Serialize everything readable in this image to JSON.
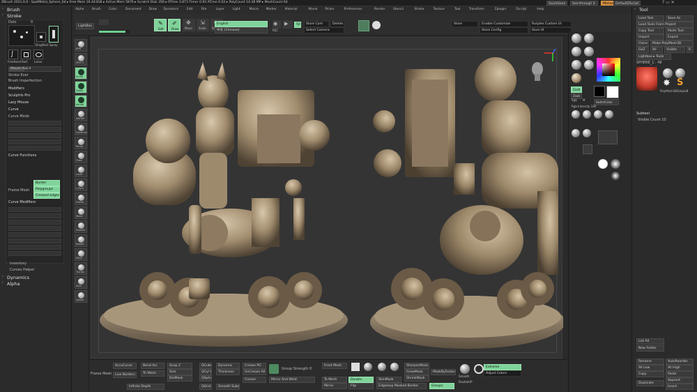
{
  "title_bar": {
    "title": "ZBrush 2021.6.6 : SpotMetal_Sphere_64 ▸ Free Mem 16.443GB ▸ Active Mem 5876 ▸ Scratch Disk 356 ▸ RTime 3.873 Timer 0.93 ATime 0.02 ▸ PolyCount 14.38 MP ▸ MeshCount 64",
    "quicksave": "QuickSave",
    "see_through": "See-through 0",
    "menus": "Menus",
    "default_zscript": "DefaultZScript"
  },
  "menu_bar": [
    "Alpha",
    "Brush",
    "Color",
    "Document",
    "Draw",
    "Dynamics",
    "Edit",
    "File",
    "Layer",
    "Light",
    "Macro",
    "Marker",
    "Material",
    "Movie",
    "Picker",
    "Preferences",
    "Render",
    "Stencil",
    "Stroke",
    "Texture",
    "Tool",
    "Transform",
    "Zplugin",
    "Zscript",
    "Help"
  ],
  "left_panel": {
    "brush_header": "Brush",
    "stroke_header": "Stroke",
    "dots_label": "Dots",
    "dots_value": "0",
    "stroke_icons": [
      "Dots",
      "DragRect",
      "Spray",
      "FreeHand",
      "Rect",
      "Lasso"
    ],
    "mouse_avg": "Mouse Avg 4",
    "stroke_button_a": "Stroke Ever",
    "stroke_button_b": "Brush Imperfection",
    "modifiers": "Modifiers",
    "sculptris_pro": "Sculptris Pro",
    "lazy_mouse": "Lazy Mouse",
    "curve": "Curve",
    "curve_mode": "Curve Mode",
    "curve_functions": "Curve Functions",
    "frame_mesh": "Frame Mesh",
    "border": "Border",
    "polygroups": "Polygroups",
    "crease_edges": "Creased edges",
    "curve_modifiers": "Curve Modifiers",
    "inventory": "Inventory",
    "curves_helper": "Curves Helper",
    "dynamics": "Dynamics",
    "alpha": "Alpha"
  },
  "top_shelf": {
    "lightbox": "LightBox",
    "edit": "Edit",
    "draw": "Draw",
    "move": "Move",
    "scale": "Scale",
    "rotate": "Rotate",
    "language": "English",
    "language_cn": "中文 (Chinese)",
    "rec": "REC",
    "zoom_label": "50",
    "store_cam": "Store Cam",
    "delete": "Delete",
    "select_camera": "Select Camera",
    "store": "Store",
    "enable_customize": "Enable Customize",
    "rurplex_custom": "Rurplex Custom UI",
    "store_config": "Store Config",
    "save_ui": "Save UI"
  },
  "left_shelf": [
    "BPR",
    "SPix 3",
    "Scroll",
    "Zoom",
    "Actual",
    "AAHalf",
    "Dynamic",
    "Persp",
    "Floor",
    "Local",
    "L.Sym",
    "Frame",
    "Move",
    "ZoomD",
    "Rotate",
    "PolyF",
    "Transp",
    "Solo",
    "Xpose"
  ],
  "right_side": {
    "tool_header": "Tool",
    "load_tool": "Load Tool",
    "save_as": "Save As",
    "load_tools_project": "Load Tools From Project",
    "copy_tool": "Copy Tool",
    "paste_tool": "Paste Tool",
    "import": "Import",
    "export": "Export",
    "clone": "Clone",
    "make_polymesh3d": "Make PolyMesh3D",
    "goz": "GoZ",
    "all": "All",
    "visible": "Visible",
    "r": "R",
    "lightbox_tools": "Lightbox ▸ Tools",
    "sphere_name": "SPHERE_1 . 48",
    "polymesh_label": "PolyMesh3D",
    "simple_brush": "SimpleB",
    "subtool": "Subtool",
    "visible_count": "Visible Count 10",
    "subtool_items": [
      "MOTO_Dn-PCDD-特别服装",
      "Body",
      "Belt",
      "Bag",
      "Chest",
      "Ren",
      "Metal",
      "Head",
      "Cloth",
      "FenE",
      "Leg",
      "Glass"
    ],
    "list_all": "List All",
    "auto_collapse": "Auto Collapse",
    "new_folder": "New Folder",
    "rename": "Rename",
    "auto_reorder": "AutoReorder",
    "all_low": "All Low",
    "all_high": "All High",
    "copy": "Copy",
    "paste": "Paste",
    "duplicate": "Duplicate",
    "append": "Append",
    "insert": "Insert"
  },
  "material_panel": {
    "rows": [
      "Cylinder3D",
      "SimpleBrush",
      "MatCap",
      "BasicMat",
      "Dup",
      "SkinShade",
      "Fill",
      "Gray"
    ],
    "sections": [
      "LazyMouse",
      "LazyRadius 1",
      "LazyStep 0.25",
      "LazySnap 0",
      "BackfaceMask",
      "Draw Size 64",
      "Z Intensity 25",
      "Focal Shift 0",
      "Dynamic",
      "Projection Strength",
      "Resolution 128",
      "Auto Groups",
      "Group Visible",
      "Undo",
      "Del Hidden",
      "Close Holes",
      "Split Unmasked Points",
      "Mask By Polygroups 0",
      "Soften",
      "Polish By Features",
      "Polish",
      "ZRemesher",
      "Creased 1",
      "Crease Angle",
      "Color Sensitivity 0.95",
      "Auto Curvature",
      "Curve 2",
      "Copy Palette Chain",
      "Create Curve"
    ],
    "zadd": "Zadd",
    "zsub": "Zsub",
    "rgb": "Rgb",
    "mrgb": "Mrgb",
    "m": "M",
    "switch_color": "SwitchColor",
    "rgb_intensity": "Rgb Intensity 100",
    "alternate": "Alternate"
  },
  "bottom": {
    "frame_mesh": "Frame Mesh",
    "accucurve": "AccuCurve",
    "live_borders": "Live Borders",
    "bend_arc": "Bend Arc",
    "tri_mesh": "Tri Mesh",
    "infinite_depth": "Infinite Depth",
    "snap": "Snap 2",
    "size": "Size",
    "del_mask": "DelMask",
    "qcube": "QCube",
    "qcyl": "QCyl Y",
    "qsphere": "QSphere",
    "qgrid": "QGrid",
    "dynamic": "Dynamic",
    "thickness": "Thickness",
    "smooth_subdiv": "Smooth Subdiv",
    "crease_pg": "Crease PG",
    "uncrease_all": "UnCrease All",
    "crease": "Crease",
    "grow_strength": "Group Strength 0",
    "mirror_and_weld": "Mirror And Weld",
    "front_mesh": "Front Mesh",
    "to_mesh": "To Mesh",
    "mirror": "Mirror",
    "double": "Double",
    "flip": "Flip",
    "skin_mask": "SkinMask",
    "edge_loop": "Edgeloop Masked Border",
    "groups": "Groups",
    "sharpen_mask": "SharpenMask",
    "grow_mask": "GrowMask",
    "shrink_mask": "ShrinkMask",
    "mask_by_feature": "MaskByFeature",
    "smooth": "Smooth",
    "doubleup": "DoubleUP",
    "polish": "Polish",
    "extreme": "Extreme",
    "adjust_colors": "Adjust Colors"
  }
}
